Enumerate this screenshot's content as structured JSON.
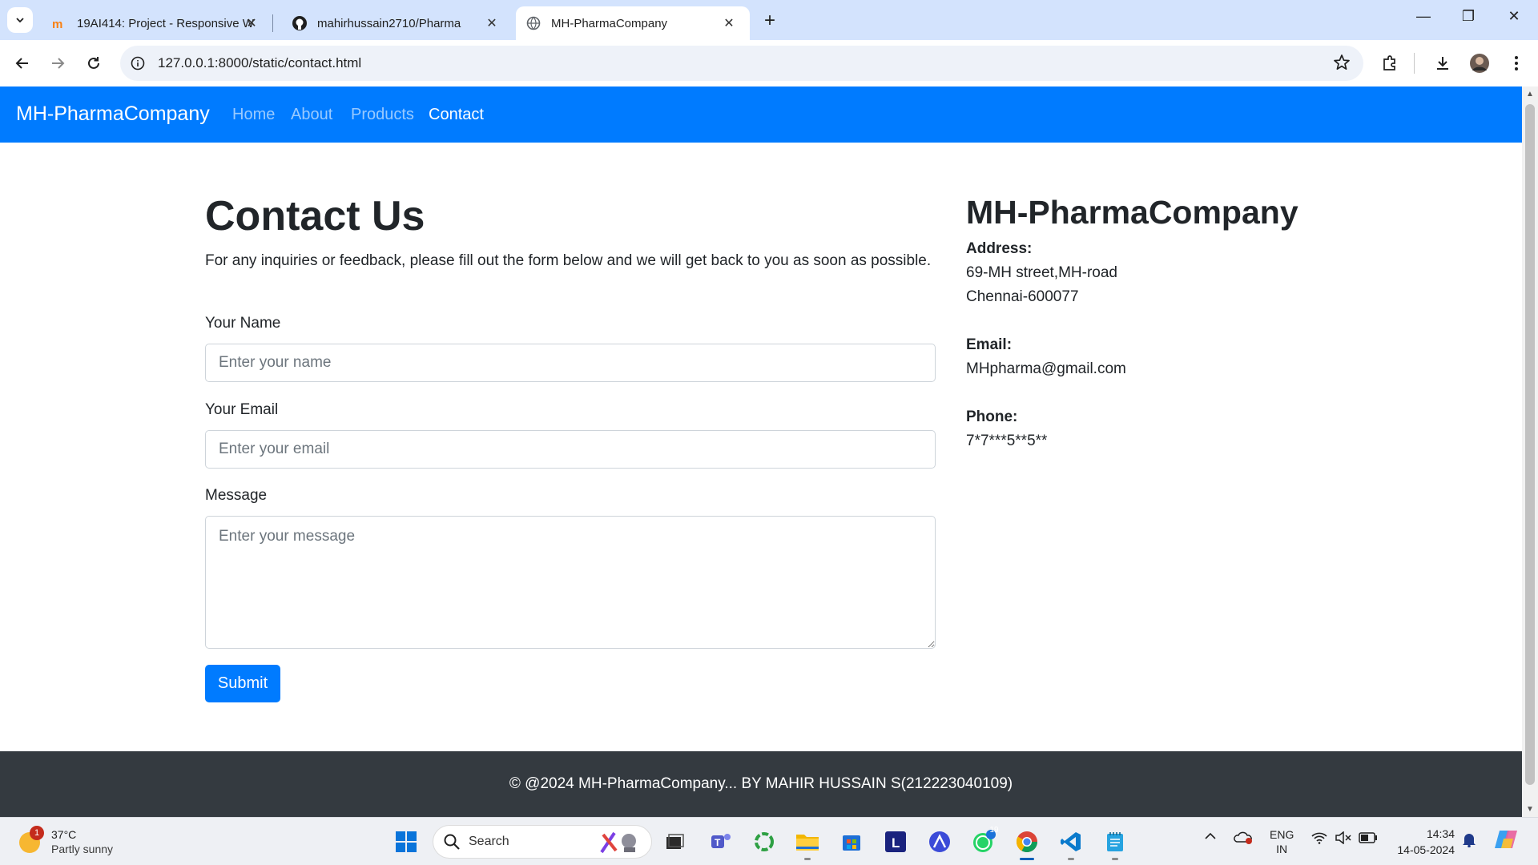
{
  "browser": {
    "tabs": [
      {
        "title": "19AI414: Project - Responsive W",
        "favicon": "moodle-icon"
      },
      {
        "title": "mahirhussain2710/Pharma",
        "favicon": "github-icon"
      },
      {
        "title": "MH-PharmaCompany",
        "favicon": "globe-icon",
        "active": true
      }
    ],
    "address": "127.0.0.1:8000/static/contact.html"
  },
  "site": {
    "brand": "MH-PharmaCompany",
    "nav": [
      "Home",
      "About",
      "Products",
      "Contact"
    ],
    "active_nav": "Contact",
    "accent_color": "#007bff"
  },
  "contact": {
    "heading": "Contact Us",
    "intro": "For any inquiries or feedback, please fill out the form below and we will get back to you as soon as possible.",
    "name_label": "Your Name",
    "name_placeholder": "Enter your name",
    "email_label": "Your Email",
    "email_placeholder": "Enter your email",
    "message_label": "Message",
    "message_placeholder": "Enter your message",
    "submit_label": "Submit"
  },
  "info": {
    "company": "MH-PharmaCompany",
    "address_label": "Address:",
    "address_line1": "69-MH street,MH-road",
    "address_line2": "Chennai-600077",
    "email_label": "Email:",
    "email": "MHpharma@gmail.com",
    "phone_label": "Phone:",
    "phone": "7*7***5**5**"
  },
  "footer": {
    "text": "© @2024 MH-PharmaCompany... BY MAHIR HUSSAIN S(212223040109)"
  },
  "taskbar": {
    "weather_badge": "1",
    "temperature": "37°C",
    "condition": "Partly sunny",
    "search_label": "Search",
    "whatsapp_badge": "19",
    "lang_top": "ENG",
    "lang_bottom": "IN",
    "time": "14:34",
    "date": "14-05-2024"
  }
}
